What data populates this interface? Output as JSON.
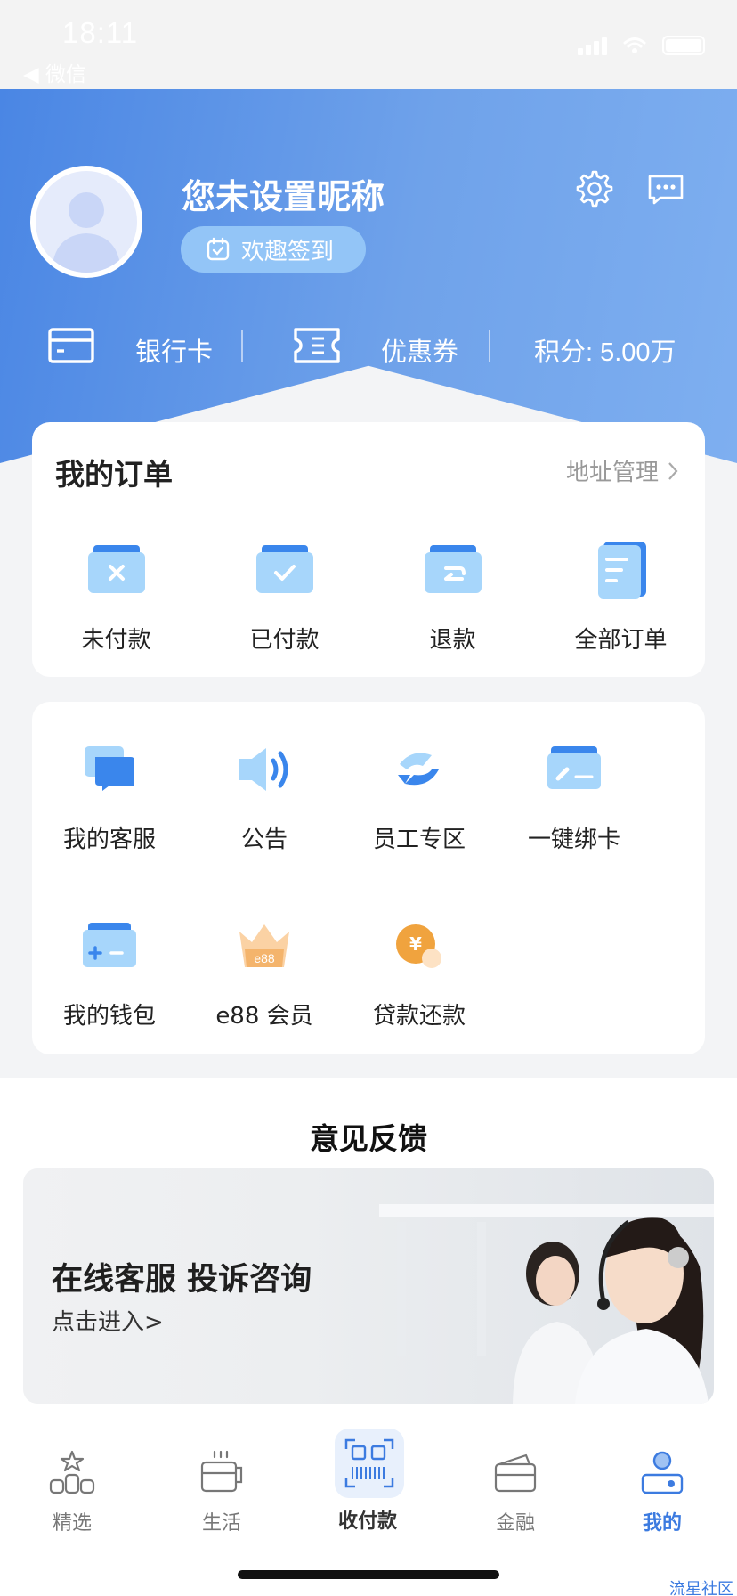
{
  "status_bar": {
    "time": "18:11",
    "back_app": "◀ 微信"
  },
  "profile": {
    "nickname": "您未设置昵称",
    "checkin_label": "欢趣签到",
    "icons": [
      "gear-icon",
      "message-icon",
      "calendar-icon",
      "avatar-placeholder"
    ]
  },
  "account": {
    "bank_card": "银行卡",
    "coupon": "优惠券",
    "points": "积分: 5.00万",
    "icons": [
      "bank-card-icon",
      "coupon-icon"
    ]
  },
  "orders": {
    "title": "我的订单",
    "address_link": "地址管理",
    "items": [
      {
        "label": "未付款",
        "icon": "unpaid-icon"
      },
      {
        "label": "已付款",
        "icon": "paid-icon"
      },
      {
        "label": "退款",
        "icon": "refund-icon"
      },
      {
        "label": "全部订单",
        "icon": "all-orders-icon"
      }
    ]
  },
  "services": {
    "items": [
      {
        "label": "我的客服",
        "icon": "customer-service-icon"
      },
      {
        "label": "公告",
        "icon": "announcement-icon"
      },
      {
        "label": "员工专区",
        "icon": "staff-zone-icon"
      },
      {
        "label": "一键绑卡",
        "icon": "bind-card-icon"
      },
      {
        "label": "我的钱包",
        "icon": "wallet-icon"
      },
      {
        "label": "e88 会员",
        "icon": "crown-icon",
        "badge": "e88"
      },
      {
        "label": "贷款还款",
        "icon": "loan-repay-icon",
        "badge": "¥"
      }
    ]
  },
  "feedback": {
    "title": "意见反馈",
    "banner_title": "在线客服 投诉咨询",
    "banner_sub": "点击进入>"
  },
  "tabbar": {
    "tabs": [
      {
        "label": "精选",
        "icon": "featured-icon"
      },
      {
        "label": "生活",
        "icon": "coffee-cup-icon"
      },
      {
        "label": "收付款",
        "icon": "scan-pay-icon"
      },
      {
        "label": "金融",
        "icon": "finance-card-icon"
      },
      {
        "label": "我的",
        "icon": "profile-icon",
        "active": true
      }
    ]
  },
  "watermark": "流星社区",
  "colors": {
    "accent": "#3c7be0",
    "header_start": "#4a86e4",
    "header_end": "#7eaff0",
    "icon_light": "#9ed0fa",
    "icon_dark": "#3a86ec"
  }
}
